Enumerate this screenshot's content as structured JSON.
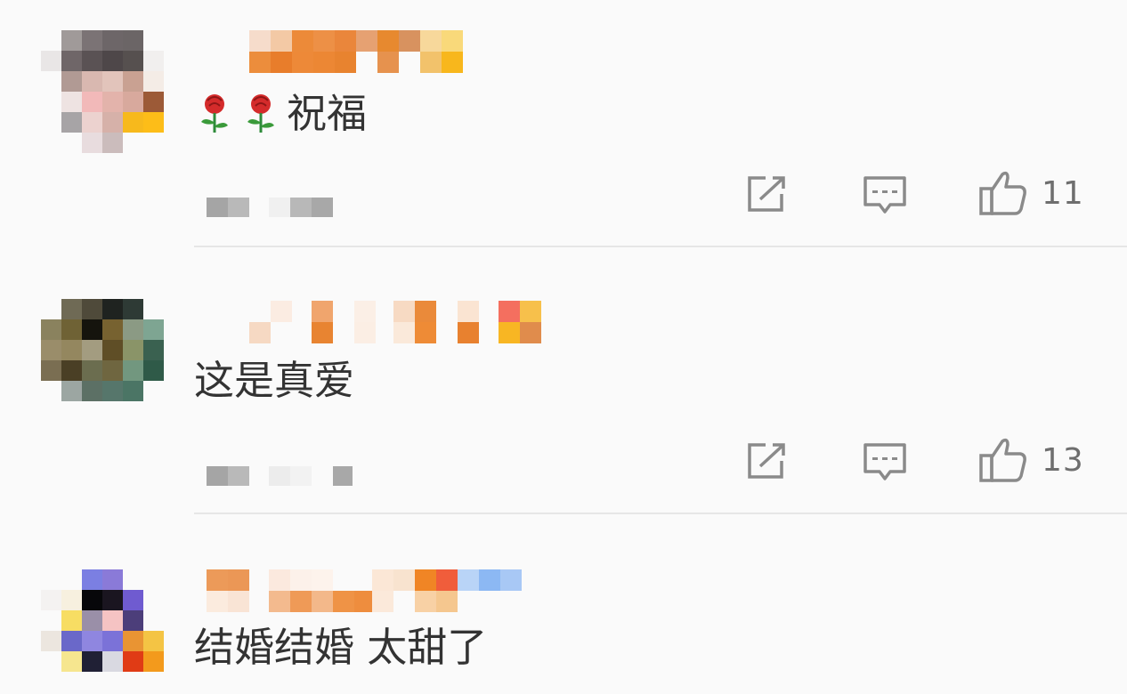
{
  "comments": [
    {
      "text": "祝福",
      "emoji": [
        "rose-icon",
        "rose-icon"
      ],
      "likes": "11",
      "share_icon": "share-icon",
      "reply_icon": "comment-icon",
      "like_icon": "thumbs-up-icon"
    },
    {
      "text": "这是真爱",
      "emoji": [],
      "likes": "13",
      "share_icon": "share-icon",
      "reply_icon": "comment-icon",
      "like_icon": "thumbs-up-icon"
    },
    {
      "text": "结婚结婚 太甜了",
      "emoji": []
    }
  ],
  "colors": {
    "icon_gray": "#8a8a8a",
    "text": "#333333",
    "divider": "#e6e6e6",
    "background": "#fafafa"
  }
}
